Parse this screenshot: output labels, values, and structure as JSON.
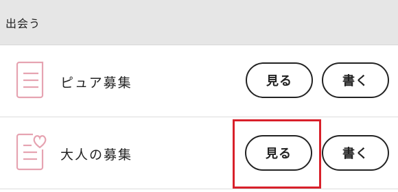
{
  "header": {
    "title": "出会う"
  },
  "rows": [
    {
      "label": "ピュア募集",
      "icon": "document-lines-icon",
      "view_label": "見る",
      "write_label": "書く"
    },
    {
      "label": "大人の募集",
      "icon": "document-heart-icon",
      "view_label": "見る",
      "write_label": "書く"
    }
  ],
  "colors": {
    "icon": "#e6a3b1",
    "highlight": "#d8202a",
    "header_bg": "#e6e6e6"
  }
}
